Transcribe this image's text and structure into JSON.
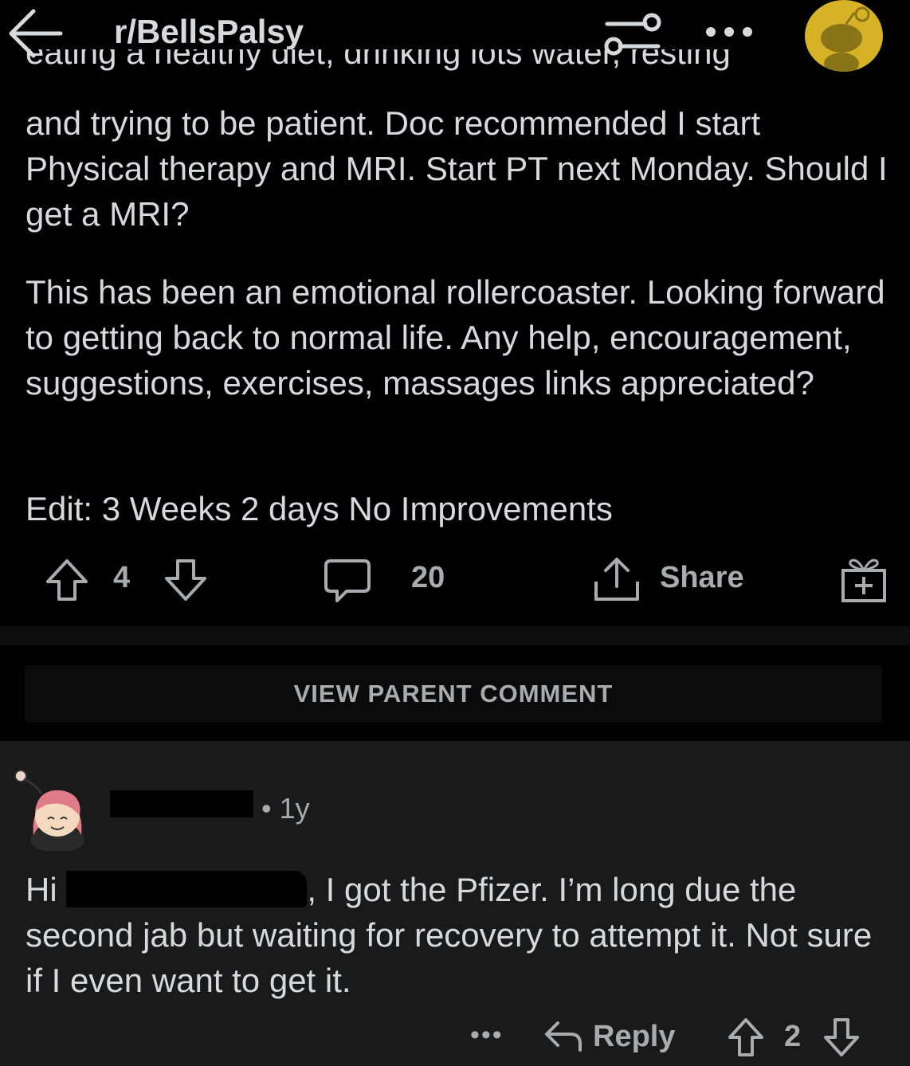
{
  "header": {
    "subreddit": "r/BellsPalsy"
  },
  "post": {
    "partial_line": "eating a healthy diet, drinking lots water, resting",
    "paragraphs": [
      "and trying to be patient. Doc recommended I start Physical therapy and MRI. Start PT next Monday. Should I get a MRI?",
      "This has been an emotional rollercoaster. Looking forward to getting back to normal life. Any help, encouragement, suggestions, exercises, massages links appreciated?",
      "Edit: 3 Weeks 2 days No Improvements"
    ],
    "votes": "4",
    "comments": "20",
    "share_label": "Share"
  },
  "view_parent_label": "VIEW PARENT COMMENT",
  "comment": {
    "time": "1y",
    "text_before": "Hi ",
    "text_after": ", I got the Pfizer. I’m long due the second jab but waiting for recovery to attempt it. Not sure if I even want to get it.",
    "more": "•••",
    "reply_label": "Reply",
    "score": "2"
  },
  "colors": {
    "background": "#000000",
    "comment_bg": "#1a1a1b",
    "text": "#d7dadc",
    "muted": "#a8acae",
    "avatar_gold": "#d8b226"
  }
}
